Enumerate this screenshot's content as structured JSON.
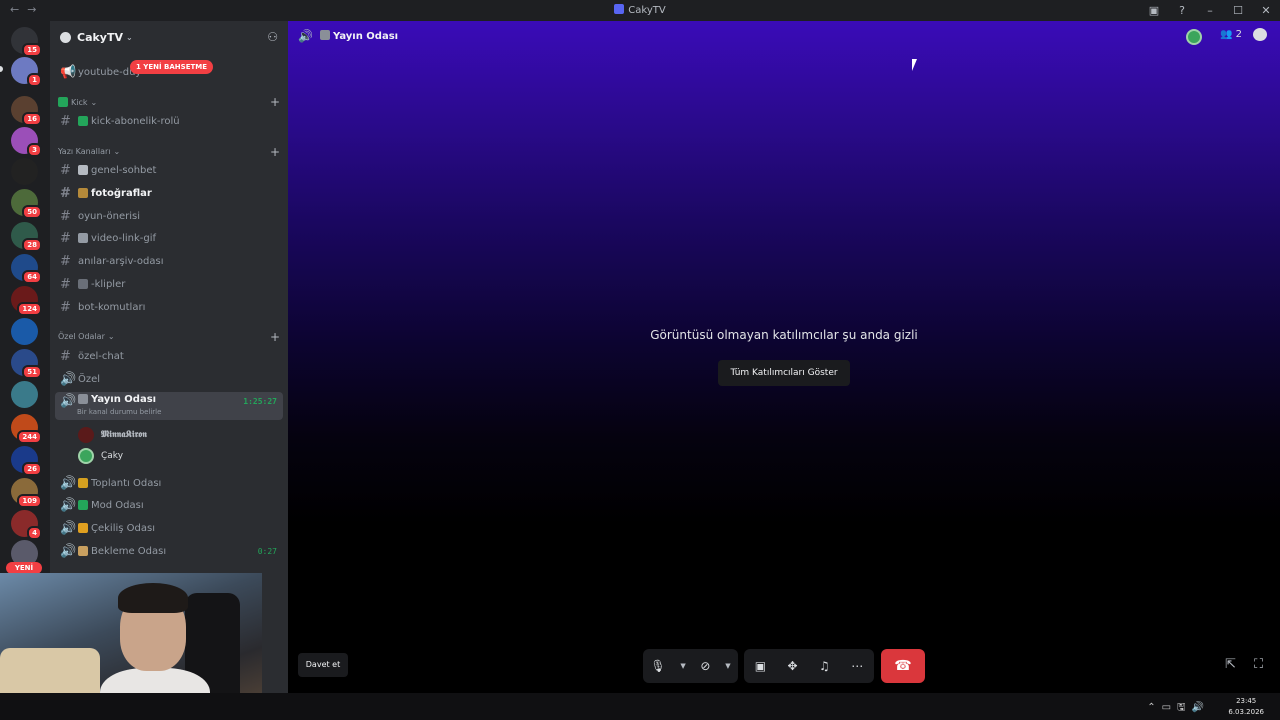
{
  "window": {
    "title": "CakyTV"
  },
  "servers": {
    "badges": [
      "15",
      "1",
      "16",
      "3",
      "50",
      "28",
      "64",
      "124",
      "51",
      "244",
      "26",
      "109",
      "4"
    ],
    "new_label": "YENİ"
  },
  "guild": {
    "name": "CakyTV",
    "mention_pill": "1 YENİ BAHSETME",
    "top_channel": "youtube-duy",
    "categories": {
      "kick": "Kick",
      "text": "Yazı Kanalları",
      "private": "Özel Odalar"
    },
    "channels": {
      "kick_sub": "kick-abonelik-rolü",
      "general": "genel-sohbet",
      "photos": "fotoğraflar",
      "game": "oyun-önerisi",
      "video": "video-link-gif",
      "memories": "anılar-arşiv-odası",
      "clips": "-klipler",
      "bot": "bot-komutları",
      "private_chat": "özel-chat",
      "private_voice": "Özel",
      "stream": "Yayın Odası",
      "stream_timer": "1:25:27",
      "stream_status": "Bir kanal durumu belirle",
      "meeting": "Toplantı Odası",
      "mod": "Mod Odası",
      "raffle": "Çekiliş Odası",
      "waiting": "Bekleme Odası",
      "waiting_timer": "0:27"
    },
    "members": [
      "𝕸𝖎𝖓𝖓𝖆𝕶𝖎𝖗𝖔𝖓",
      "Çaky"
    ]
  },
  "main": {
    "channel_name": "Yayın Odası",
    "participants": "2",
    "hidden_message": "Görüntüsü olmayan katılımcılar şu anda gizli",
    "show_button": "Tüm Katılımcıları Göster",
    "invite_button": "Davet et"
  },
  "taskbar": {
    "time": "23:45",
    "date": "6.03.2026"
  },
  "colors": {
    "accent_purple": "#3a0bb8",
    "hangup": "#da373c",
    "active_green": "#23a55a",
    "badge_red": "#f23f43"
  }
}
